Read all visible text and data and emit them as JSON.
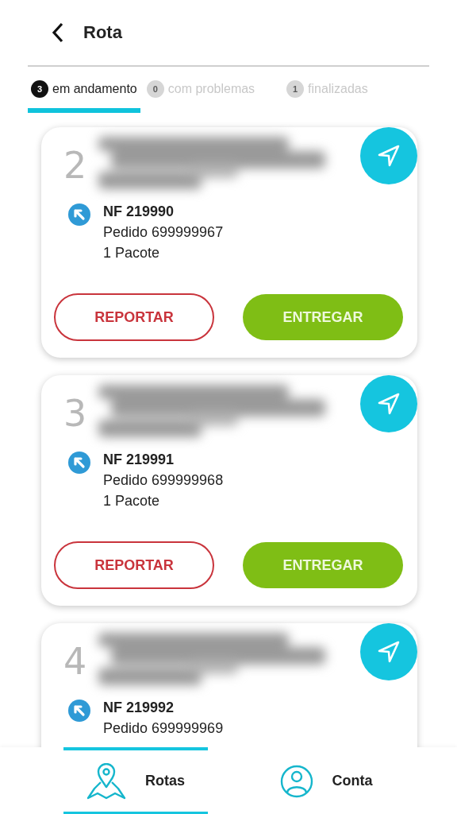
{
  "header": {
    "title": "Rota"
  },
  "tabs": [
    {
      "count": "3",
      "label": "em andamento",
      "selected": true
    },
    {
      "count": "0",
      "label": "com problemas",
      "selected": false
    },
    {
      "count": "1",
      "label": "finalizadas",
      "selected": false
    }
  ],
  "stops": [
    {
      "number": "2",
      "invoice": "NF 219990",
      "order": "Pedido 699999967",
      "packages": "1 Pacote",
      "buttons": [
        {
          "kind": "outline",
          "label": "REPORTAR"
        },
        {
          "kind": "filled",
          "label": "ENTREGAR"
        }
      ]
    },
    {
      "number": "3",
      "invoice": "NF 219991",
      "order": "Pedido 699999968",
      "packages": "1 Pacote",
      "buttons": [
        {
          "kind": "outline",
          "label": "REPORTAR"
        },
        {
          "kind": "filled",
          "label": "ENTREGAR"
        }
      ]
    },
    {
      "number": "4",
      "invoice": "NF 219992",
      "order": "Pedido 699999969"
    }
  ],
  "nav": [
    {
      "label": "Rotas",
      "selected": true
    },
    {
      "label": "Conta",
      "selected": false
    }
  ]
}
